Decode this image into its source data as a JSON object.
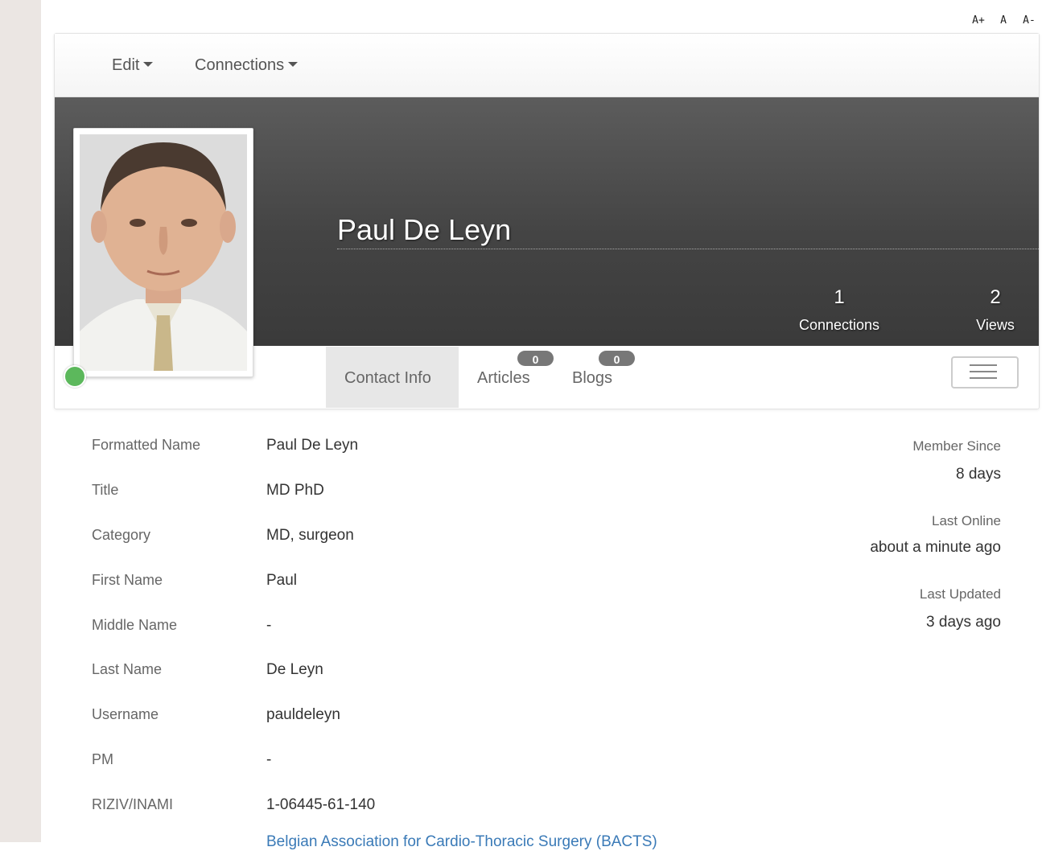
{
  "font_controls": {
    "increase": "A+",
    "normal": "A",
    "decrease": "A-"
  },
  "toolbar": {
    "edit_label": "Edit",
    "connections_label": "Connections"
  },
  "profile": {
    "name": "Paul De Leyn",
    "online_status_color": "#5cb85c",
    "stats": {
      "connections": {
        "value": "1",
        "label": "Connections"
      },
      "views": {
        "value": "2",
        "label": "Views"
      }
    }
  },
  "tabs": [
    {
      "label": "Contact Info"
    },
    {
      "label": "Articles",
      "badge": "0"
    },
    {
      "label": "Blogs",
      "badge": "0"
    }
  ],
  "fields": [
    {
      "label": "Formatted Name",
      "value": "Paul De Leyn"
    },
    {
      "label": "Title",
      "value": "MD PhD"
    },
    {
      "label": "Category",
      "value": "MD, surgeon"
    },
    {
      "label": "First Name",
      "value": "Paul"
    },
    {
      "label": "Middle Name",
      "value": "-"
    },
    {
      "label": "Last Name",
      "value": "De Leyn"
    },
    {
      "label": "Username",
      "value": "pauldeleyn"
    },
    {
      "label": "PM",
      "value": "-"
    },
    {
      "label": "RIZIV/INAMI",
      "value": "1-06445-61-140"
    }
  ],
  "partial_link": "Belgian Association for Cardio-Thoracic Surgery (BACTS)",
  "meta": {
    "member_since": {
      "label": "Member Since",
      "value": "8 days"
    },
    "last_online": {
      "label": "Last Online",
      "value": "about a minute ago"
    },
    "last_updated": {
      "label": "Last Updated",
      "value": "3 days ago"
    }
  }
}
